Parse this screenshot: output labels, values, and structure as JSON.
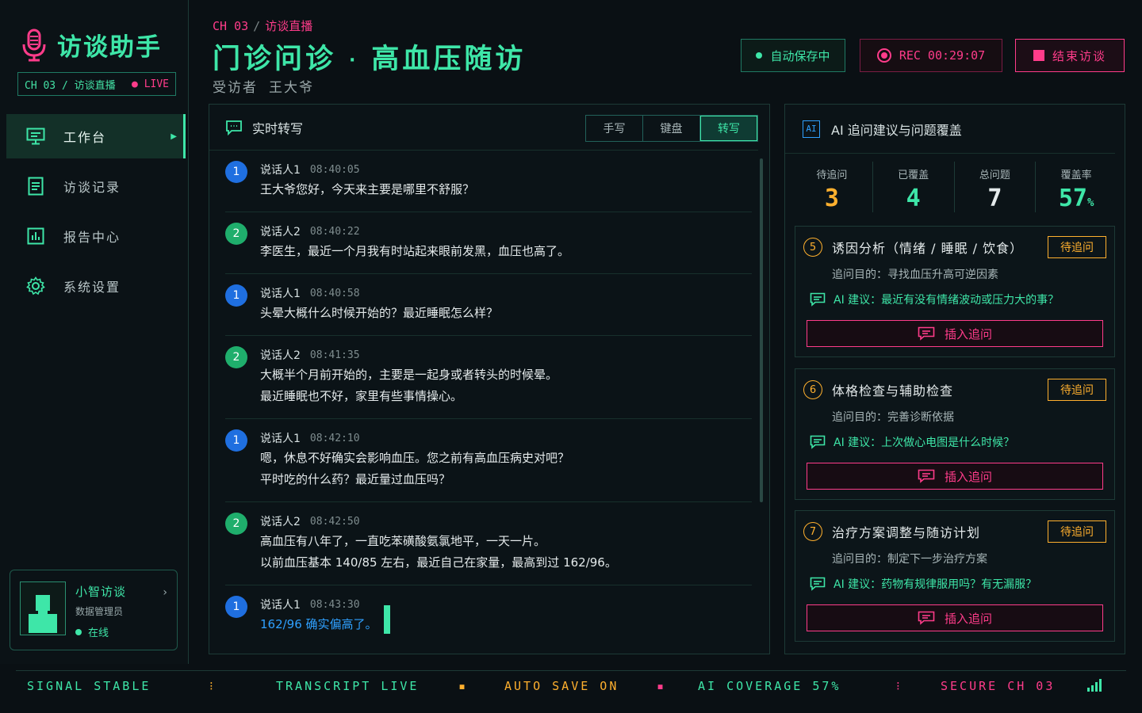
{
  "app": {
    "title": "访谈助手",
    "channel": "CH 03 / 访谈直播",
    "live": "LIVE"
  },
  "nav": [
    {
      "label": "工作台",
      "icon": "monitor-icon",
      "active": true
    },
    {
      "label": "访谈记录",
      "icon": "document-icon",
      "active": false
    },
    {
      "label": "报告中心",
      "icon": "bar-chart-icon",
      "active": false
    },
    {
      "label": "系统设置",
      "icon": "gear-icon",
      "active": false
    }
  ],
  "user": {
    "name": "小智访谈",
    "role": "数据管理员",
    "status": "在线"
  },
  "header": {
    "breadcrumb_channel": "CH 03",
    "breadcrumb_sep": "/",
    "breadcrumb_page": "访谈直播",
    "title_left": "门诊问诊",
    "title_sep": "·",
    "title_right": "高血压随访",
    "subject_label": "受访者",
    "subject_name": "王大爷",
    "autosave": "自动保存中",
    "rec": "REC 00:29:07",
    "end": "结束访谈"
  },
  "transcript": {
    "title": "实时转写",
    "modes": [
      "手写",
      "键盘",
      "转写"
    ],
    "active_mode": "转写",
    "messages": [
      {
        "num": "1",
        "speaker": "说话人1",
        "time": "08:40:05",
        "lines": [
          "王大爷您好，今天来主要是哪里不舒服？"
        ]
      },
      {
        "num": "2",
        "speaker": "说话人2",
        "time": "08:40:22",
        "lines": [
          "李医生，最近一个月我有时站起来眼前发黑，血压也高了。"
        ]
      },
      {
        "num": "1",
        "speaker": "说话人1",
        "time": "08:40:58",
        "lines": [
          "头晕大概什么时候开始的？最近睡眠怎么样？"
        ]
      },
      {
        "num": "2",
        "speaker": "说话人2",
        "time": "08:41:35",
        "lines": [
          "大概半个月前开始的，主要是一起身或者转头的时候晕。",
          "最近睡眠也不好，家里有些事情操心。"
        ]
      },
      {
        "num": "1",
        "speaker": "说话人1",
        "time": "08:42:10",
        "lines": [
          "嗯，休息不好确实会影响血压。您之前有高血压病史对吧？",
          "平时吃的什么药？最近量过血压吗？"
        ]
      },
      {
        "num": "2",
        "speaker": "说话人2",
        "time": "08:42:50",
        "lines": [
          "高血压有八年了，一直吃苯磺酸氨氯地平，一天一片。",
          "以前血压基本 140/85 左右，最近自己在家量，最高到过 162/96。"
        ]
      },
      {
        "num": "1",
        "speaker": "说话人1",
        "time": "08:43:30",
        "lines": [
          "162/96 确实偏高了。"
        ]
      }
    ]
  },
  "ai": {
    "title": "AI 追问建议与问题覆盖",
    "badge": "AI",
    "stats": [
      {
        "label": "待追问",
        "value": "3",
        "color": "#ffb02e"
      },
      {
        "label": "已覆盖",
        "value": "4",
        "color": "#3ee6a8"
      },
      {
        "label": "总问题",
        "value": "7",
        "color": "#e4eaeb"
      },
      {
        "label": "覆盖率",
        "value": "57",
        "unit": "%",
        "color": "#3ee6a8"
      }
    ],
    "cards": [
      {
        "num": "5",
        "title": "诱因分析（情绪 / 睡眠 / 饮食）",
        "tag": "待追问",
        "purpose": "追问目的：寻找血压升高可逆因素",
        "suggestion": "AI 建议：最近有没有情绪波动或压力大的事？",
        "button": "插入追问"
      },
      {
        "num": "6",
        "title": "体格检查与辅助检查",
        "tag": "待追问",
        "purpose": "追问目的：完善诊断依据",
        "suggestion": "AI 建议：上次做心电图是什么时候？",
        "button": "插入追问"
      },
      {
        "num": "7",
        "title": "治疗方案调整与随访计划",
        "tag": "待追问",
        "purpose": "追问目的：制定下一步治疗方案",
        "suggestion": "AI 建议：药物有规律服用吗？有无漏服？",
        "button": "插入追问"
      }
    ]
  },
  "statusbar": {
    "signal": "SIGNAL STABLE",
    "transcript": "TRANSCRIPT LIVE",
    "autosave": "AUTO SAVE ON",
    "coverage": "AI COVERAGE 57%",
    "secure": "SECURE CH 03"
  }
}
